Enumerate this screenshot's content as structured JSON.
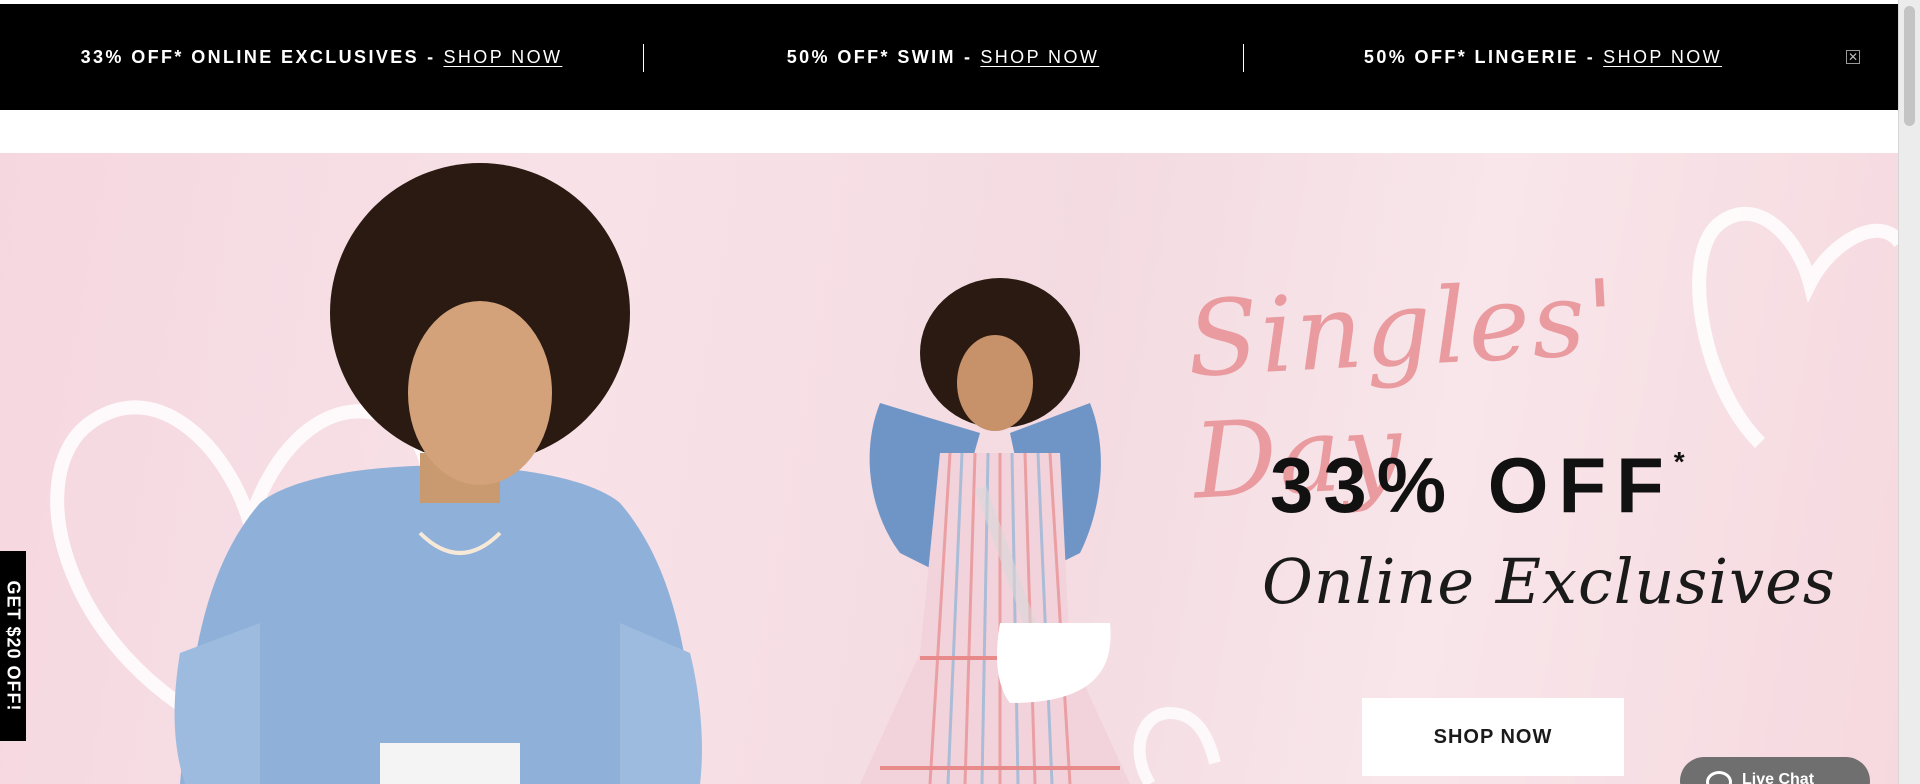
{
  "promo_bar": {
    "items": [
      {
        "text": "33% OFF* ONLINE EXCLUSIVES",
        "separator": "-",
        "link": "SHOP NOW"
      },
      {
        "text": "50% OFF* SWIM",
        "separator": "-",
        "link": "SHOP NOW"
      },
      {
        "text": "50% OFF* LINGERIE",
        "separator": "-",
        "link": "SHOP NOW"
      }
    ],
    "close_icon": "close-icon",
    "close_glyph": "✕"
  },
  "hero": {
    "script_title": "Singles' Day",
    "offer": "33% OFF",
    "offer_asterisk": "*",
    "subtitle": "Online Exclusives",
    "cta": "SHOP NOW"
  },
  "side_tab": {
    "label": "GET $20 OFF!"
  },
  "chat": {
    "icon": "chat-bubble-icon",
    "label": "Live Chat"
  },
  "colors": {
    "promo_bg": "#000000",
    "hero_pink": "#f5d7df",
    "script_pink": "#ea9b9f",
    "denim_blue": "#8fb0d8",
    "chat_gray": "#6f6f6f"
  }
}
